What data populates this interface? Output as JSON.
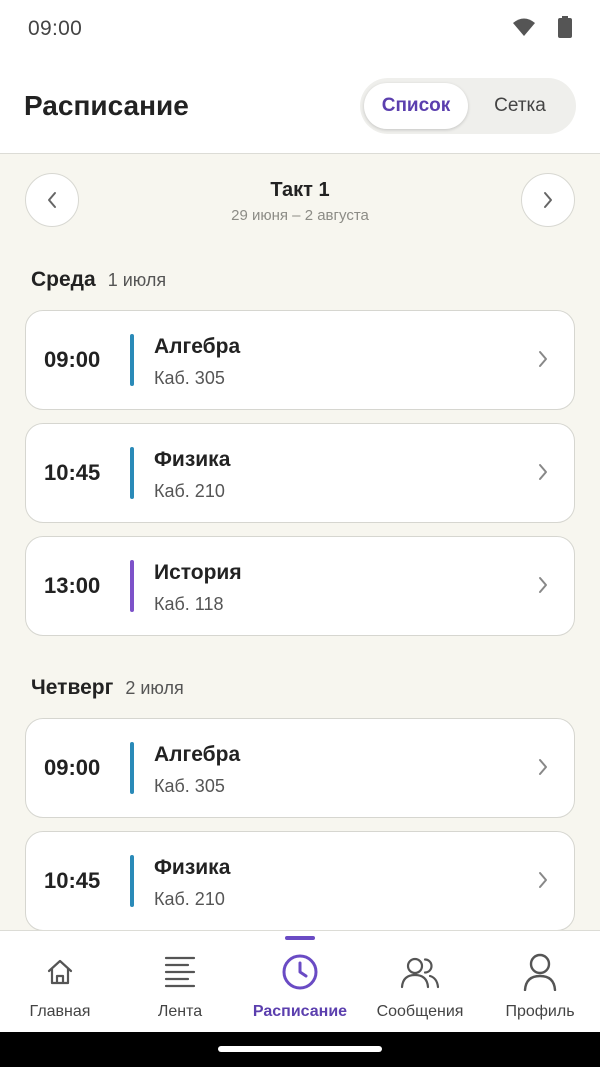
{
  "status_bar": {
    "time": "09:00"
  },
  "header": {
    "title": "Расписание",
    "view_list_label": "Список",
    "view_grid_label": "Сетка"
  },
  "period": {
    "title": "Такт 1",
    "range": "29 июня – 2 августа"
  },
  "days": [
    {
      "name": "Среда",
      "date": "1 июля",
      "lessons": [
        {
          "time": "09:00",
          "subject": "Алгебра",
          "room": "Каб. 305",
          "color": "#2a8ab8"
        },
        {
          "time": "10:45",
          "subject": "Физика",
          "room": "Каб. 210",
          "color": "#2a8ab8"
        },
        {
          "time": "13:00",
          "subject": "История",
          "room": "Каб. 118",
          "color": "#7d52c9"
        }
      ]
    },
    {
      "name": "Четверг",
      "date": "2 июля",
      "lessons": [
        {
          "time": "09:00",
          "subject": "Алгебра",
          "room": "Каб. 305",
          "color": "#2a8ab8"
        },
        {
          "time": "10:45",
          "subject": "Физика",
          "room": "Каб. 210",
          "color": "#2a8ab8"
        }
      ]
    }
  ],
  "bottom_nav": {
    "items": [
      {
        "label": "Главная",
        "icon": "home-icon"
      },
      {
        "label": "Лента",
        "icon": "feed-icon"
      },
      {
        "label": "Расписание",
        "icon": "clock-icon",
        "active": true
      },
      {
        "label": "Сообщения",
        "icon": "messages-icon"
      },
      {
        "label": "Профиль",
        "icon": "profile-icon"
      }
    ]
  },
  "colors": {
    "accent": "#5b3fae",
    "background": "#f7f6ef",
    "math_physics_bar": "#2a8ab8",
    "history_bar": "#7d52c9"
  }
}
